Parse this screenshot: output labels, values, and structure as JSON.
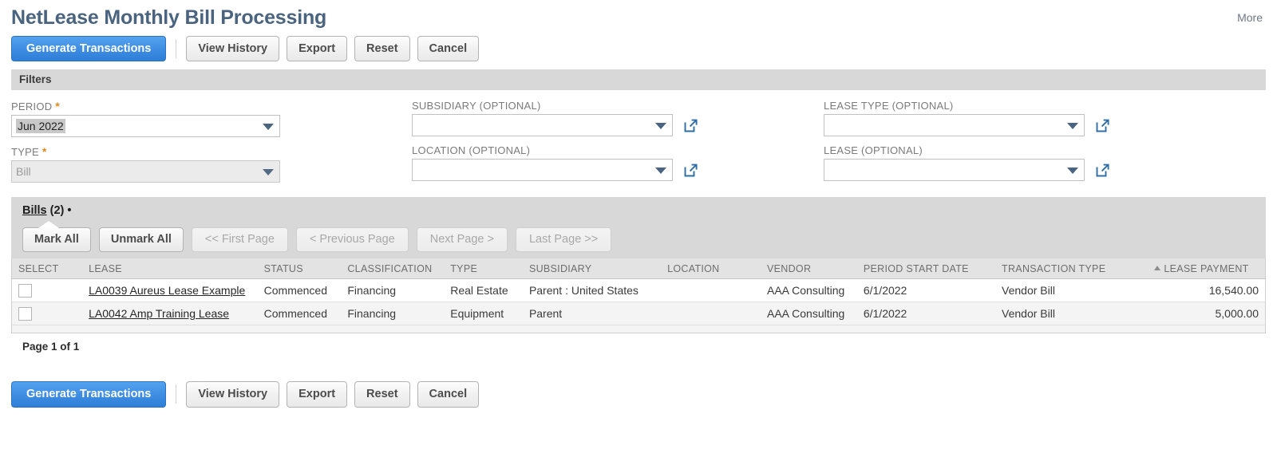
{
  "header": {
    "title": "NetLease Monthly Bill Processing",
    "more_label": "More"
  },
  "toolbar": {
    "primary_label": "Generate Transactions",
    "view_history_label": "View History",
    "export_label": "Export",
    "reset_label": "Reset",
    "cancel_label": "Cancel"
  },
  "filters": {
    "section_label": "Filters",
    "period": {
      "label": "PERIOD",
      "required": "*",
      "value": "Jun 2022"
    },
    "type": {
      "label": "TYPE",
      "required": "*",
      "value": "Bill"
    },
    "subsidiary": {
      "label": "SUBSIDIARY (OPTIONAL)",
      "value": "",
      "popup_icon": "open-external-icon"
    },
    "location": {
      "label": "LOCATION (OPTIONAL)",
      "value": "",
      "popup_icon": "open-external-icon"
    },
    "lease_type": {
      "label": "LEASE TYPE (OPTIONAL)",
      "value": "",
      "popup_icon": "open-external-icon"
    },
    "lease": {
      "label": "LEASE (OPTIONAL)",
      "value": "",
      "popup_icon": "open-external-icon"
    }
  },
  "sublist": {
    "tab_name": "Bills",
    "tab_count": "(2)",
    "tab_dot": "•",
    "mark_all_label": "Mark All",
    "unmark_all_label": "Unmark All",
    "first_page_label": "<< First Page",
    "previous_page_label": "< Previous Page",
    "next_page_label": "Next Page >",
    "last_page_label": "Last Page >>",
    "page_of_label": "Page 1 of 1"
  },
  "table": {
    "columns": [
      "SELECT",
      "LEASE",
      "STATUS",
      "CLASSIFICATION",
      "TYPE",
      "SUBSIDIARY",
      "LOCATION",
      "VENDOR",
      "PERIOD START DATE",
      "TRANSACTION TYPE",
      "LEASE PAYMENT"
    ],
    "sorted_column": "LEASE PAYMENT",
    "sort_direction": "ascending",
    "rows": [
      {
        "selected": false,
        "lease": "LA0039 Aureus Lease Example",
        "status": "Commenced",
        "classification": "Financing",
        "type": "Real Estate",
        "subsidiary": "Parent : United States",
        "location": "",
        "vendor": "AAA Consulting",
        "period_start_date": "6/1/2022",
        "transaction_type": "Vendor Bill",
        "lease_payment": "16,540.00"
      },
      {
        "selected": false,
        "lease": "LA0042 Amp Training Lease",
        "status": "Commenced",
        "classification": "Financing",
        "type": "Equipment",
        "subsidiary": "Parent",
        "location": "",
        "vendor": "AAA Consulting",
        "period_start_date": "6/1/2022",
        "transaction_type": "Vendor Bill",
        "lease_payment": "5,000.00"
      }
    ]
  },
  "colors": {
    "primary_button": "#3f8ee3",
    "title": "#4a6480",
    "section_bar": "#d8d8d8",
    "required_asterisk": "#e08a1e",
    "table_header": "#e3e3e3"
  }
}
